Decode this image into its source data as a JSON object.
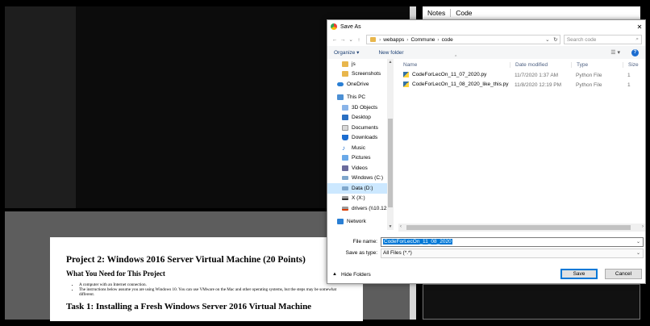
{
  "doc": {
    "heading": "Project 2: Windows 2016 Server Virtual Machine (20 Points)",
    "subheading": "What You Need for This Project",
    "bullets": [
      "A computer with an Internet connection.",
      "The instructions below assume you are using Windows 10. You can use VMware on the Mac and other operating systems, but the steps may be somewhat different."
    ],
    "task_heading": "Task 1: Installing a Fresh Windows Server 2016 Virtual Machine"
  },
  "notes": {
    "tab_notes": "Notes",
    "tab_code": "Code"
  },
  "dialog": {
    "title": "Save As",
    "close_glyph": "✕",
    "nav_back": "←",
    "nav_forward": "→",
    "nav_recent": "⌄",
    "nav_up": "↑",
    "breadcrumb": [
      "webapps",
      "Commune",
      "code"
    ],
    "search_placeholder": "Search code",
    "organize_label": "Organize ▾",
    "new_folder_label": "New folder",
    "help_label": "?",
    "view_label": "☰ ▾",
    "nav_items": [
      {
        "label": "js",
        "icon": "folder-icon"
      },
      {
        "label": "Screenshots",
        "icon": "folder-icon"
      },
      {
        "label": "OneDrive",
        "icon": "cloud-icon"
      },
      {
        "label": "This PC",
        "icon": "pc-icon"
      },
      {
        "label": "3D Objects",
        "icon": "3d-objects-icon"
      },
      {
        "label": "Desktop",
        "icon": "desktop-icon"
      },
      {
        "label": "Documents",
        "icon": "documents-icon"
      },
      {
        "label": "Downloads",
        "icon": "downloads-icon"
      },
      {
        "label": "Music",
        "icon": "music-icon"
      },
      {
        "label": "Pictures",
        "icon": "pictures-icon"
      },
      {
        "label": "Videos",
        "icon": "videos-icon"
      },
      {
        "label": "Windows (C:)",
        "icon": "drive-icon"
      },
      {
        "label": "Data (D:)",
        "icon": "drive-icon"
      },
      {
        "label": "X (X:)",
        "icon": "network-drive-icon"
      },
      {
        "label": "drivers (\\\\10.121",
        "icon": "network-drive-error-icon"
      },
      {
        "label": "Network",
        "icon": "network-icon"
      }
    ],
    "columns": {
      "name": "Name",
      "date": "Date modified",
      "type": "Type",
      "size": "Size"
    },
    "files": [
      {
        "name": "CodeForLecOn_11_07_2020.py",
        "date": "11/7/2020 1:37 AM",
        "type": "Python File",
        "size": "1"
      },
      {
        "name": "CodeForLecOn_11_08_2020_like_this.py",
        "date": "11/8/2020 12:19 PM",
        "type": "Python File",
        "size": "1"
      }
    ],
    "file_name_label": "File name:",
    "file_name_value": "CodeForLecOn_11_08_2020",
    "save_type_label": "Save as type:",
    "save_type_value": "All Files (*.*)",
    "hide_folders_label": "Hide Folders",
    "save_button": "Save",
    "cancel_button": "Cancel"
  }
}
